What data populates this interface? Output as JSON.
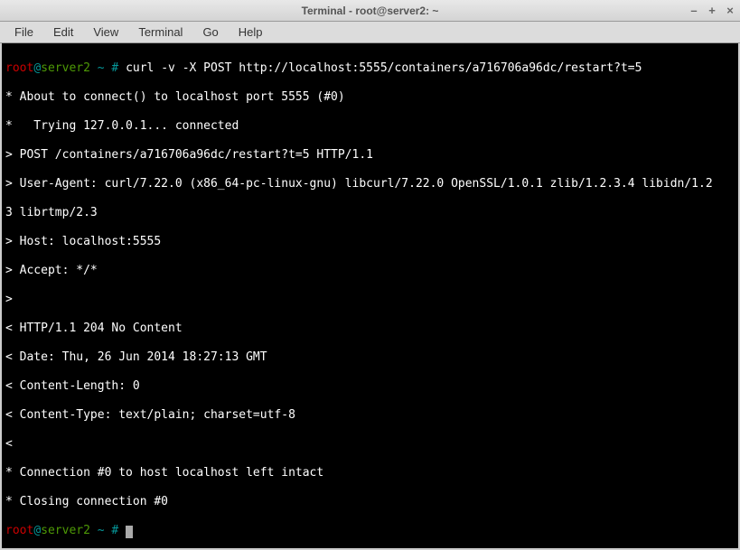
{
  "window": {
    "title": "Terminal - root@server2: ~"
  },
  "menu": {
    "file": "File",
    "edit": "Edit",
    "view": "View",
    "terminal": "Terminal",
    "go": "Go",
    "help": "Help"
  },
  "prompt": {
    "user": "root",
    "at": "@",
    "host": "server2",
    "path": " ~ #",
    "cmd": " curl -v -X POST http://localhost:5555/containers/a716706a96dc/restart?t=5"
  },
  "out": {
    "l1": "* About to connect() to localhost port 5555 (#0)",
    "l2": "*   Trying 127.0.0.1... connected",
    "l3": "> POST /containers/a716706a96dc/restart?t=5 HTTP/1.1",
    "l4": "> User-Agent: curl/7.22.0 (x86_64-pc-linux-gnu) libcurl/7.22.0 OpenSSL/1.0.1 zlib/1.2.3.4 libidn/1.2",
    "l5": "3 librtmp/2.3",
    "l6": "> Host: localhost:5555",
    "l7": "> Accept: */*",
    "l8": ">",
    "l9": "< HTTP/1.1 204 No Content",
    "l10": "< Date: Thu, 26 Jun 2014 18:27:13 GMT",
    "l11": "< Content-Length: 0",
    "l12": "< Content-Type: text/plain; charset=utf-8",
    "l13": "<",
    "l14": "* Connection #0 to host localhost left intact",
    "l15": "* Closing connection #0"
  },
  "prompt2": {
    "user": "root",
    "at": "@",
    "host": "server2",
    "path": " ~ # "
  }
}
